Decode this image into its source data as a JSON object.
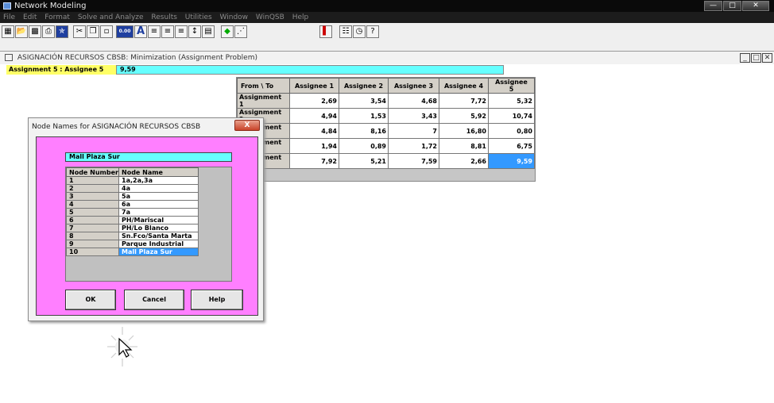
{
  "window": {
    "title": "Network Modeling"
  },
  "menu": [
    "File",
    "Edit",
    "Format",
    "Solve and Analyze",
    "Results",
    "Utilities",
    "Window",
    "WinQSB",
    "Help"
  ],
  "toolbar": {
    "icons": [
      "grid-icon",
      "open-icon",
      "save-icon",
      "print-icon",
      "special-icon",
      "cut-icon",
      "copy-icon",
      "paste-icon",
      "number-format-icon",
      "font-icon",
      "align-left-icon",
      "align-center-icon",
      "align-right-icon",
      "column-width-icon",
      "row-height-icon",
      "solve-icon",
      "graph-icon",
      "chart-icon",
      "table-icon",
      "clock-icon",
      "help-icon"
    ],
    "number_format_label": "0.00",
    "font_label": "A",
    "help_label": "?"
  },
  "doc_window": {
    "title": "ASIGNACIÓN RECURSOS CBSB: Minimization (Assignment Problem)"
  },
  "cell_ref": {
    "label": "Assignment 5 : Assignee 5",
    "value": "9,59"
  },
  "grid": {
    "corner": "From \\ To",
    "columns": [
      "Assignee 1",
      "Assignee 2",
      "Assignee 3",
      "Assignee 4",
      "Assignee 5"
    ],
    "rows": [
      {
        "label": "Assignment 1",
        "values": [
          "2,69",
          "3,54",
          "4,68",
          "7,72",
          "5,32"
        ]
      },
      {
        "label": "Assignment 2",
        "values": [
          "4,94",
          "1,53",
          "3,43",
          "5,92",
          "10,74"
        ]
      },
      {
        "label": "Assignment 3",
        "values": [
          "4,84",
          "8,16",
          "7",
          "16,80",
          "0,80"
        ]
      },
      {
        "label": "Assignment 4",
        "values": [
          "1,94",
          "0,89",
          "1,72",
          "8,81",
          "6,75"
        ]
      },
      {
        "label": "Assignment 5",
        "values": [
          "7,92",
          "5,21",
          "7,59",
          "2,66",
          "9,59"
        ]
      }
    ],
    "covered_row_labels": [
      "ment 4",
      "ment 5"
    ]
  },
  "dialog": {
    "title": "Node Names for ASIGNACIÓN RECURSOS CBSB",
    "close_label": "X",
    "current_name": "Mall Plaza Sur",
    "col_number": "Node Number",
    "col_name": "Node Name",
    "nodes": [
      {
        "number": "1",
        "name": "1a,2a,3a"
      },
      {
        "number": "2",
        "name": "4a"
      },
      {
        "number": "3",
        "name": "5a"
      },
      {
        "number": "4",
        "name": "6a"
      },
      {
        "number": "5",
        "name": "7a"
      },
      {
        "number": "6",
        "name": "PH/Mariscal"
      },
      {
        "number": "7",
        "name": "PH/Lo Blanco"
      },
      {
        "number": "8",
        "name": "Sn.Fco/Santa Marta"
      },
      {
        "number": "9",
        "name": "Parque Industrial"
      },
      {
        "number": "10",
        "name": "Mall Plaza Sur"
      }
    ],
    "ok": "OK",
    "cancel": "Cancel",
    "help": "Help"
  }
}
